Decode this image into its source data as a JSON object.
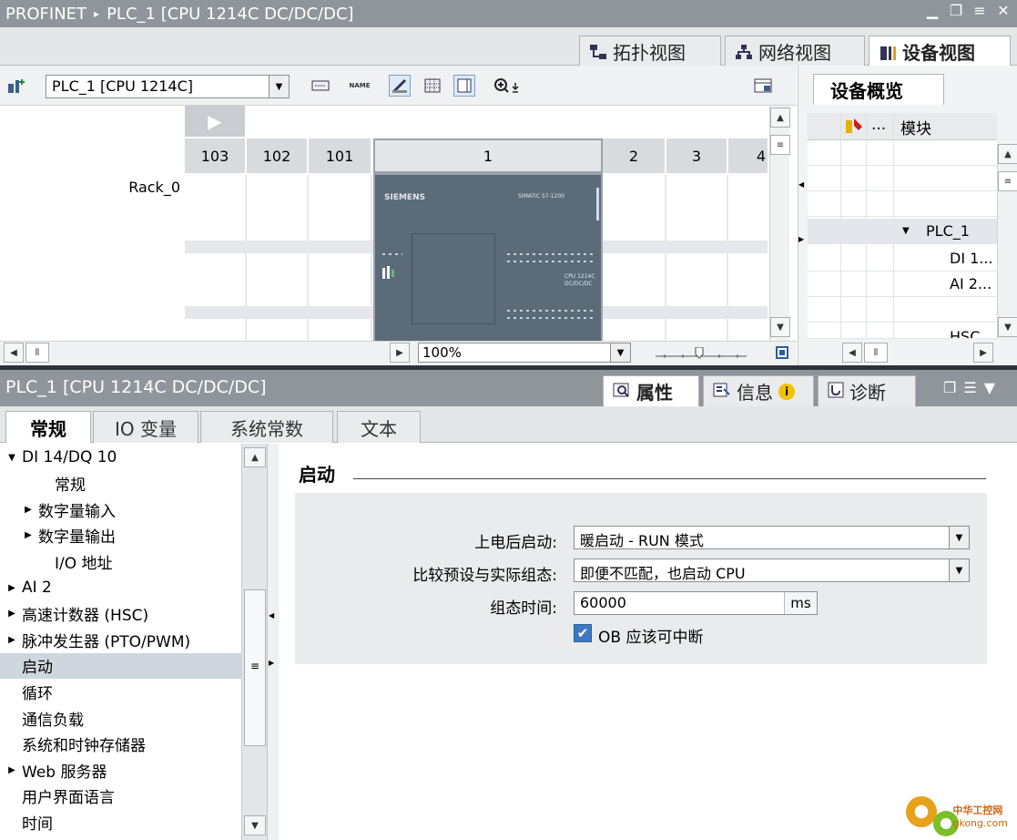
{
  "window": {
    "breadcrumb_root": "PROFINET",
    "breadcrumb_sep": "▸",
    "breadcrumb_device": "PLC_1 [CPU 1214C DC/DC/DC]"
  },
  "view_tabs": [
    {
      "label": "拓扑视图"
    },
    {
      "label": "网络视图"
    },
    {
      "label": "设备视图"
    }
  ],
  "device_toolbar": {
    "device_select": "PLC_1 [CPU 1214C]",
    "name_icon_text": "NAME"
  },
  "rack": {
    "label": "Rack_0",
    "slots": [
      "103",
      "102",
      "101",
      "1",
      "2",
      "3",
      "4"
    ],
    "cpu_brand": "SIEMENS",
    "cpu_model": "SIMATIC S7-1200",
    "cpu_type_line1": "CPU 1214C",
    "cpu_type_line2": "DC/DC/DC"
  },
  "zoom": {
    "value": "100%"
  },
  "overview": {
    "tab_label": "设备概览",
    "col_more": "...",
    "col_module": "模块",
    "rows": [
      "PLC_1",
      "DI 1...",
      "AI 2...",
      "",
      "HSC"
    ]
  },
  "properties": {
    "title": "PLC_1 [CPU 1214C DC/DC/DC]",
    "tabs": [
      "属性",
      "信息",
      "诊断"
    ],
    "info_badge": "i"
  },
  "inspector_tabs": [
    "常规",
    "IO 变量",
    "系统常数",
    "文本"
  ],
  "nav": [
    {
      "label": "DI 14/DQ 10",
      "tri": "▼",
      "indent": 0
    },
    {
      "label": "常规",
      "tri": "",
      "indent": 2
    },
    {
      "label": "数字量输入",
      "tri": "▶",
      "indent": 1
    },
    {
      "label": "数字量输出",
      "tri": "▶",
      "indent": 1
    },
    {
      "label": "I/O 地址",
      "tri": "",
      "indent": 2
    },
    {
      "label": "AI 2",
      "tri": "▶",
      "indent": 0
    },
    {
      "label": "高速计数器 (HSC)",
      "tri": "▶",
      "indent": 0
    },
    {
      "label": "脉冲发生器 (PTO/PWM)",
      "tri": "▶",
      "indent": 0
    },
    {
      "label": "启动",
      "tri": "",
      "indent": 0,
      "selected": true
    },
    {
      "label": "循环",
      "tri": "",
      "indent": 0
    },
    {
      "label": "通信负载",
      "tri": "",
      "indent": 0
    },
    {
      "label": "系统和时钟存储器",
      "tri": "",
      "indent": 0
    },
    {
      "label": "Web 服务器",
      "tri": "▶",
      "indent": 0
    },
    {
      "label": "用户界面语言",
      "tri": "",
      "indent": 0
    },
    {
      "label": "时间",
      "tri": "",
      "indent": 0
    }
  ],
  "startup": {
    "section_title": "启动",
    "power_up_label": "上电后启动:",
    "power_up_value": "暖启动 - RUN 模式",
    "compare_label": "比较预设与实际组态:",
    "compare_value": "即便不匹配，也启动 CPU",
    "config_time_label": "组态时间:",
    "config_time_value": "60000",
    "config_time_unit": "ms",
    "ob_interruptible_label": "OB 应该可中断",
    "ob_interruptible_checked": true
  },
  "watermark": {
    "line1": "中华工控网",
    "line2": "gkong.com"
  },
  "colors": {
    "titlebar": "#8f959b",
    "accent": "#3d79c1",
    "selection": "#cfd6dd"
  }
}
